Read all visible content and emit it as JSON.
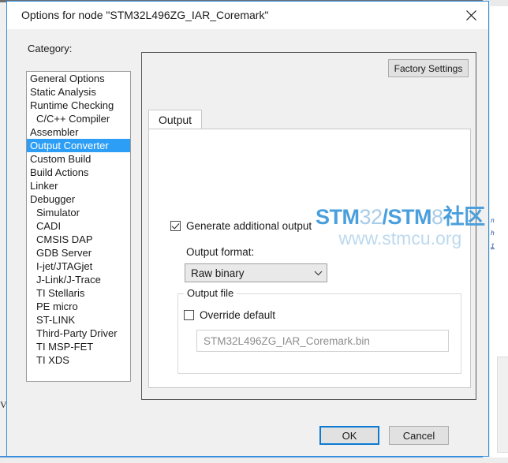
{
  "dialog": {
    "title": "Options for node \"STM32L496ZG_IAR_Coremark\"",
    "close_icon": "close-icon"
  },
  "sidebar": {
    "label": "Category:",
    "items": [
      {
        "label": "General Options",
        "indent": false,
        "selected": false
      },
      {
        "label": "Static Analysis",
        "indent": false,
        "selected": false
      },
      {
        "label": "Runtime Checking",
        "indent": false,
        "selected": false
      },
      {
        "label": "C/C++ Compiler",
        "indent": true,
        "selected": false
      },
      {
        "label": "Assembler",
        "indent": false,
        "selected": false
      },
      {
        "label": "Output Converter",
        "indent": false,
        "selected": true
      },
      {
        "label": "Custom Build",
        "indent": false,
        "selected": false
      },
      {
        "label": "Build Actions",
        "indent": false,
        "selected": false
      },
      {
        "label": "Linker",
        "indent": false,
        "selected": false
      },
      {
        "label": "Debugger",
        "indent": false,
        "selected": false
      },
      {
        "label": "Simulator",
        "indent": true,
        "selected": false
      },
      {
        "label": "CADI",
        "indent": true,
        "selected": false
      },
      {
        "label": "CMSIS DAP",
        "indent": true,
        "selected": false
      },
      {
        "label": "GDB Server",
        "indent": true,
        "selected": false
      },
      {
        "label": "I-jet/JTAGjet",
        "indent": true,
        "selected": false
      },
      {
        "label": "J-Link/J-Trace",
        "indent": true,
        "selected": false
      },
      {
        "label": "TI Stellaris",
        "indent": true,
        "selected": false
      },
      {
        "label": "PE micro",
        "indent": true,
        "selected": false
      },
      {
        "label": "ST-LINK",
        "indent": true,
        "selected": false
      },
      {
        "label": "Third-Party Driver",
        "indent": true,
        "selected": false
      },
      {
        "label": "TI MSP-FET",
        "indent": true,
        "selected": false
      },
      {
        "label": "TI XDS",
        "indent": true,
        "selected": false
      }
    ]
  },
  "panel": {
    "factory_settings_label": "Factory Settings",
    "tabs": [
      {
        "label": "Output",
        "active": true
      }
    ],
    "generate_additional_output": {
      "label": "Generate additional output",
      "checked": true
    },
    "output_format": {
      "label": "Output format:",
      "value": "Raw binary",
      "arrow_icon": "chevron-down-icon"
    },
    "output_file": {
      "legend": "Output file",
      "override_default": {
        "label": "Override default",
        "checked": false
      },
      "filename": "STM32L496ZG_IAR_Coremark.bin"
    }
  },
  "footer": {
    "ok_label": "OK",
    "cancel_label": "Cancel"
  },
  "watermark": {
    "line1_part1": "STM",
    "line1_part2": "32",
    "line1_part3": "/STM",
    "line1_part4": "8",
    "line1_part5": "社区",
    "line2": "www.stmcu.org",
    "color_strong": "#4a9fdc",
    "color_dim": "#a9cce8"
  },
  "background": {
    "code_line1": "n",
    "code_line2": "h",
    "code_line3": "1",
    "left_glyph": "V"
  }
}
